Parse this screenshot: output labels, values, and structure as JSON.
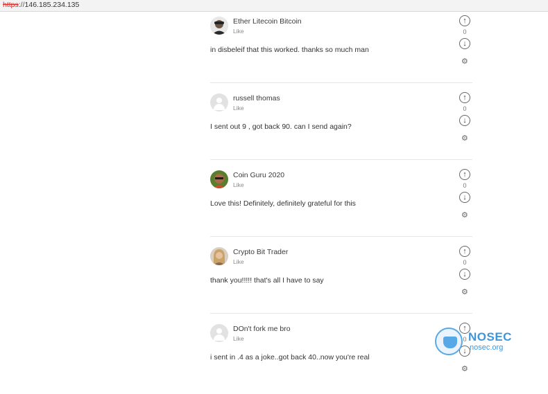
{
  "browser": {
    "url_scheme": "https",
    "url_separator": "://",
    "url_host": "146.185.234.135"
  },
  "comments": [
    {
      "author": "Ether Litecoin Bitcoin",
      "like": "Like",
      "text": "in disbeleif that this worked. thanks so much man",
      "votes": "0"
    },
    {
      "author": "russell thomas",
      "like": "Like",
      "text": "I sent out 9 , got back 90. can I send again?",
      "votes": "0"
    },
    {
      "author": "Coin Guru 2020",
      "like": "Like",
      "text": "Love this! Definitely, definitely grateful for this",
      "votes": "0"
    },
    {
      "author": "Crypto Bit Trader",
      "like": "Like",
      "text": "thank you!!!!! that's all I have to say",
      "votes": "0"
    },
    {
      "author": "DOn't fork me bro",
      "like": "Like",
      "text": "i sent in .4 as a joke..got back 40..now you're real",
      "votes": "0"
    }
  ],
  "icons": {
    "upvote": "arrow-up-circle-icon",
    "downvote": "arrow-down-circle-icon",
    "settings": "gear-icon",
    "avatar_default": "user-silhouette-icon"
  },
  "watermark": {
    "name": "NOSEC",
    "site": "nosec.org",
    "color": "#3f95d9"
  }
}
